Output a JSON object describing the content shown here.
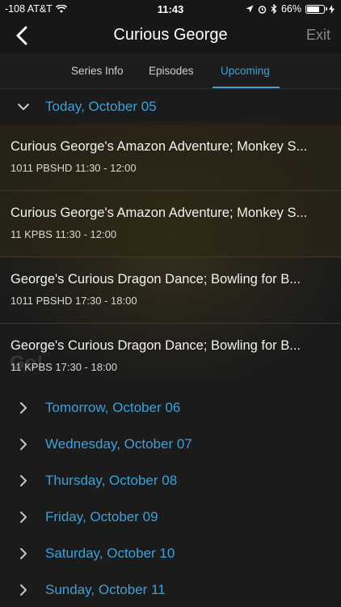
{
  "status": {
    "signal": "-108 AT&T",
    "time": "11:43",
    "battery": "66%"
  },
  "nav": {
    "title": "Curious George",
    "exit_label": "Exit"
  },
  "tabs": [
    {
      "label": "Series Info",
      "active": false
    },
    {
      "label": "Episodes",
      "active": false
    },
    {
      "label": "Upcoming",
      "active": true
    }
  ],
  "background_text": "Go!",
  "days": [
    {
      "label": "Today, October 05",
      "expanded": true,
      "episodes": [
        {
          "title": "Curious George's Amazon Adventure; Monkey S...",
          "meta": "1011 PBSHD 11:30 - 12:00"
        },
        {
          "title": "Curious George's Amazon Adventure; Monkey S...",
          "meta": "11 KPBS 11:30 - 12:00"
        },
        {
          "title": "George's Curious Dragon Dance; Bowling for B...",
          "meta": "1011 PBSHD 17:30 - 18:00"
        },
        {
          "title": "George's Curious Dragon Dance; Bowling for B...",
          "meta": "11 KPBS 17:30 - 18:00"
        }
      ]
    },
    {
      "label": "Tomorrow, October 06",
      "expanded": false
    },
    {
      "label": "Wednesday, October 07",
      "expanded": false
    },
    {
      "label": "Thursday, October 08",
      "expanded": false
    },
    {
      "label": "Friday, October 09",
      "expanded": false
    },
    {
      "label": "Saturday, October 10",
      "expanded": false
    },
    {
      "label": "Sunday, October 11",
      "expanded": false
    }
  ],
  "colors": {
    "accent": "#3fa0d8",
    "background": "#1b1b1b"
  }
}
